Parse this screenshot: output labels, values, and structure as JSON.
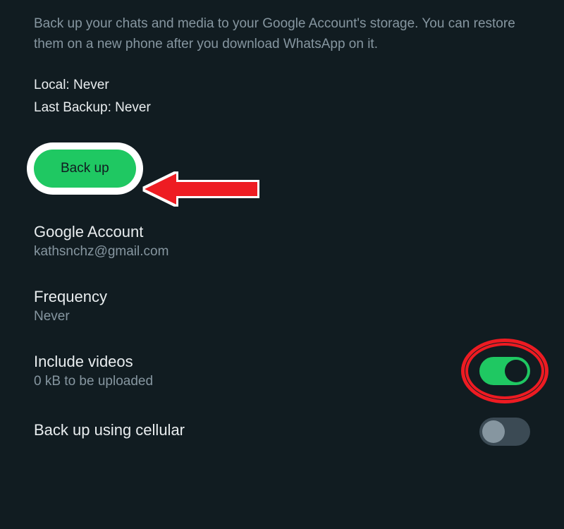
{
  "description": "Back up your chats and media to your Google Account's storage. You can restore them on a new phone after you download WhatsApp on it.",
  "status": {
    "local": "Local: Never",
    "last_backup": "Last Backup: Never"
  },
  "backup_button": "Back up",
  "settings": {
    "google_account": {
      "title": "Google Account",
      "value": "kathsnchz@gmail.com"
    },
    "frequency": {
      "title": "Frequency",
      "value": "Never"
    },
    "include_videos": {
      "title": "Include videos",
      "subtitle": "0 kB to be uploaded",
      "enabled": true
    },
    "backup_cellular": {
      "title": "Back up using cellular",
      "enabled": false
    }
  }
}
